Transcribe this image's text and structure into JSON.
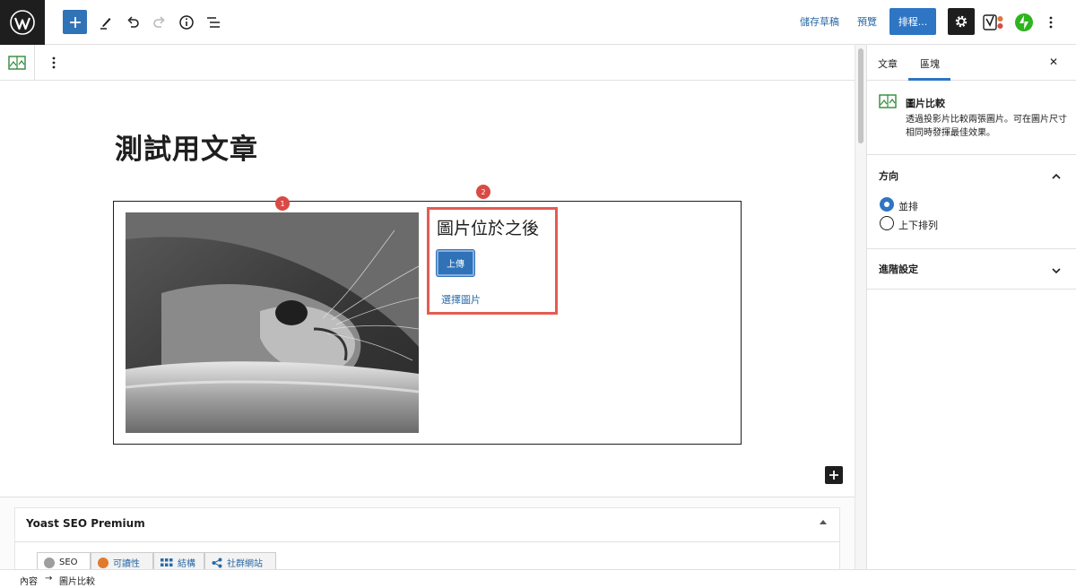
{
  "toolbar": {
    "save_draft": "儲存草稿",
    "preview": "預覽",
    "schedule": "排程..."
  },
  "editor": {
    "post_title": "測試用文章",
    "compare_block": {
      "badge_1": "1",
      "badge_2": "2",
      "after_title": "圖片位於之後",
      "upload_label": "上傳",
      "select_image_label": "選擇圖片"
    }
  },
  "yoast": {
    "title": "Yoast SEO Premium",
    "tabs": [
      {
        "label": "SEO",
        "icon": "seo-circle-icon"
      },
      {
        "label": "可讀性",
        "icon": "readability-smiley-icon"
      },
      {
        "label": "結構",
        "icon": "schema-grid-icon"
      },
      {
        "label": "社群網站",
        "icon": "share-icon"
      }
    ]
  },
  "statusbar": {
    "crumb_root": "內容",
    "crumb_current": "圖片比較"
  },
  "sidebar": {
    "tab_post": "文章",
    "tab_block": "區塊",
    "close": "✕",
    "block_title": "圖片比較",
    "block_desc": "透過投影片比較兩張圖片。可在圖片尺寸相同時發揮最佳效果。",
    "direction_title": "方向",
    "options": [
      {
        "label": "並排",
        "checked": true
      },
      {
        "label": "上下排列",
        "checked": false
      }
    ],
    "advanced_title": "進階設定"
  },
  "colors": {
    "accent": "#2e75c4",
    "highlight": "#e45c53",
    "badge": "#d94a44"
  }
}
